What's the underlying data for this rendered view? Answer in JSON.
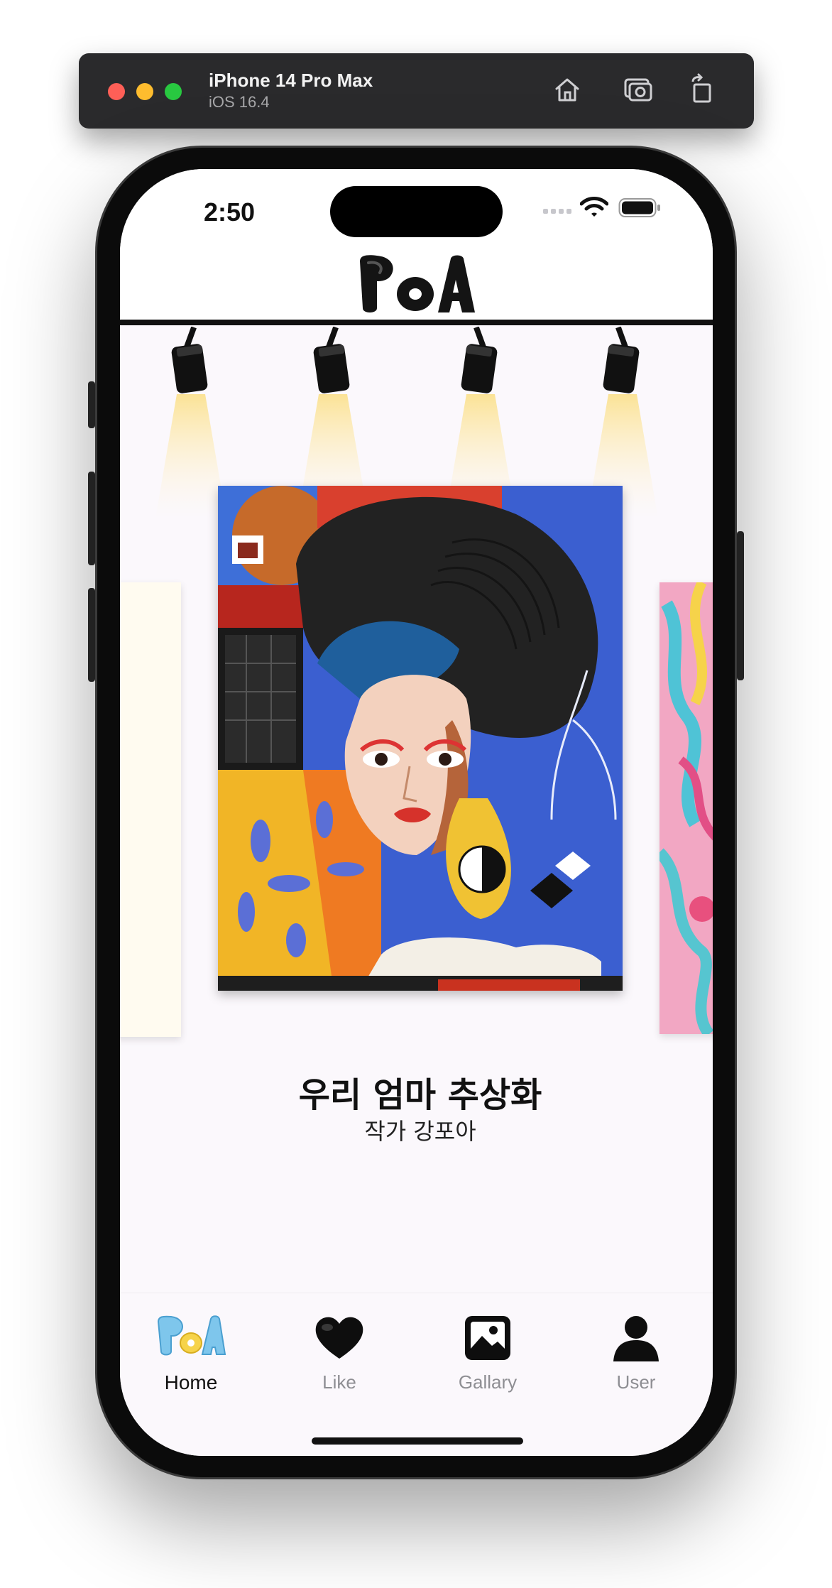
{
  "simulator": {
    "device_name": "iPhone 14 Pro Max",
    "os_version": "iOS 16.4",
    "icons": [
      "home-icon",
      "screenshot-icon",
      "rotate-icon"
    ]
  },
  "status_bar": {
    "time": "2:50",
    "icons": [
      "cellular-icon",
      "wifi-icon",
      "battery-icon"
    ]
  },
  "app": {
    "logo_text": "PoA"
  },
  "artwork": {
    "title": "우리 엄마 추상화",
    "artist": "작가 강포아"
  },
  "tabbar": {
    "items": [
      {
        "label": "Home",
        "icon": "poa-logo-icon",
        "active": true
      },
      {
        "label": "Like",
        "icon": "heart-icon",
        "active": false
      },
      {
        "label": "Gallary",
        "icon": "gallery-icon",
        "active": false
      },
      {
        "label": "User",
        "icon": "user-icon",
        "active": false
      }
    ]
  },
  "colors": {
    "background": "#fbf8fc",
    "accent_light": "#fbe08a",
    "active_tab": "#111111",
    "inactive_tab": "#8e8e93"
  }
}
